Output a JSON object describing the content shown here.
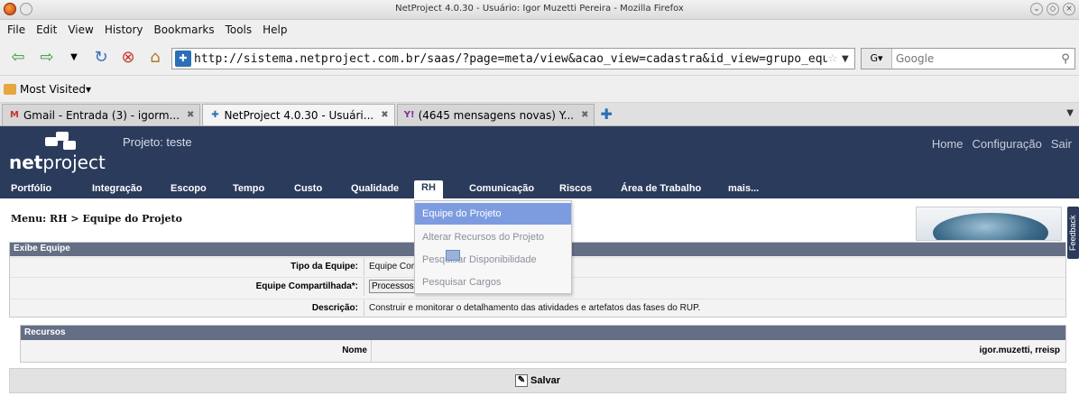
{
  "window": {
    "title": "NetProject 4.0.30 - Usuário: Igor Muzetti Pereira - Mozilla Firefox"
  },
  "menu": [
    "File",
    "Edit",
    "View",
    "History",
    "Bookmarks",
    "Tools",
    "Help"
  ],
  "navbar": {
    "url": "http://sistema.netproject.com.br/saas/?page=meta/view&acao_view=cadastra&id_view=grupo_equipe_projet",
    "search_placeholder": "Google"
  },
  "bookmarks": {
    "most_visited": "Most Visited▾"
  },
  "tabs": [
    {
      "label": "Gmail - Entrada (3) - igorm...",
      "icon": "gmail-icon"
    },
    {
      "label": "NetProject 4.0.30 - Usuári...",
      "icon": "netproject-icon",
      "active": true
    },
    {
      "label": "(4645 mensagens novas) Y...",
      "icon": "yahoo-icon"
    }
  ],
  "app": {
    "logo_bold": "net",
    "logo_rest": "project",
    "projeto": "Projeto: teste",
    "toplinks": [
      "Home",
      "Configuração",
      "Sair"
    ],
    "nav": [
      "Portfólio",
      "Integração",
      "Escopo",
      "Tempo",
      "Custo",
      "Qualidade",
      "RH",
      "Comunicação",
      "Riscos",
      "Área de Trabalho",
      "mais..."
    ],
    "active_nav": "RH"
  },
  "breadcrumb": "Menu: RH > Equipe do Projeto",
  "feedback_label": "Feedback",
  "dropdown": [
    "Equipe do Projeto",
    "Alterar Recursos do Projeto",
    "Pesquisar Disponibilidade",
    "Pesquisar Cargos"
  ],
  "exibe": {
    "title": "Exibe Equipe",
    "tipo_label": "Tipo da Equipe:",
    "tipo_value": "Equipe Cor",
    "compart_label": "Equipe Compartilhada*:",
    "compart_value": "Processos",
    "descricao_label": "Descrição:",
    "descricao_value": "Construir e monitorar o detalhamento das atividades e artefatos das fases do RUP."
  },
  "recursos": {
    "title": "Recursos",
    "nome_label": "Nome",
    "nome_value": "igor.muzetti, rreisp"
  },
  "save_label": "Salvar"
}
